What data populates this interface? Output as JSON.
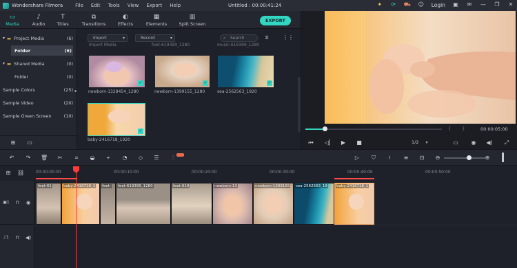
{
  "app": {
    "name": "Wondershare Filmora",
    "title": "Untitled : 00:00:41:24",
    "login_label": "Login"
  },
  "menu": [
    "File",
    "Edit",
    "Tools",
    "View",
    "Export",
    "Help"
  ],
  "tabs": [
    {
      "label": "Media",
      "icon": "folder-icon"
    },
    {
      "label": "Audio",
      "icon": "music-note-icon"
    },
    {
      "label": "Titles",
      "icon": "text-icon"
    },
    {
      "label": "Transitions",
      "icon": "transition-icon"
    },
    {
      "label": "Effects",
      "icon": "effects-icon"
    },
    {
      "label": "Elements",
      "icon": "elements-icon"
    },
    {
      "label": "Split Screen",
      "icon": "split-screen-icon"
    }
  ],
  "export_label": "EXPORT",
  "sidebar": {
    "items": [
      {
        "label": "Project Media",
        "count": "(6)"
      },
      {
        "label": "Folder",
        "count": "(6)"
      },
      {
        "label": "Shared Media",
        "count": "(0)"
      },
      {
        "label": "Folder",
        "count": "(0)"
      },
      {
        "label": "Sample Colors",
        "count": "(25)"
      },
      {
        "label": "Sample Video",
        "count": "(20)"
      },
      {
        "label": "Sample Green Screen",
        "count": "(10)"
      }
    ]
  },
  "media": {
    "import_label": "Import",
    "record_label": "Record",
    "search_placeholder": "Search",
    "top_partial_labels": [
      "Import Media",
      "feet-619399_1280",
      "music-619399_1280"
    ],
    "items": [
      {
        "name": "newborn-1328454_1280"
      },
      {
        "name": "newborn-1399155_1280"
      },
      {
        "name": "sea-2562563_1920"
      },
      {
        "name": "baby-2416718_1920"
      }
    ]
  },
  "preview": {
    "time": "00:00:05:00",
    "ratio": "1/2",
    "progress": 0.14
  },
  "timeline": {
    "ruler": [
      "00:00:00:00",
      "00:00:10:00",
      "00:00:20:00",
      "00:00:30:00",
      "00:00:40:00",
      "00:00:50:00"
    ],
    "clips": [
      {
        "label": "feet-61"
      },
      {
        "label": "baby-2416718_1"
      },
      {
        "label": "feet-"
      },
      {
        "label": "feet-619399_1280"
      },
      {
        "label": "feet-619"
      },
      {
        "label": "newborn-13"
      },
      {
        "label": "newborn-1399155"
      },
      {
        "label": "sea-2562563_19"
      },
      {
        "label": "baby-2416718_1"
      }
    ],
    "zoom": 0.6
  },
  "colors": {
    "accent": "#33d6c3",
    "playhead": "#ff3b3b",
    "selected_clip": "#ffb067"
  }
}
